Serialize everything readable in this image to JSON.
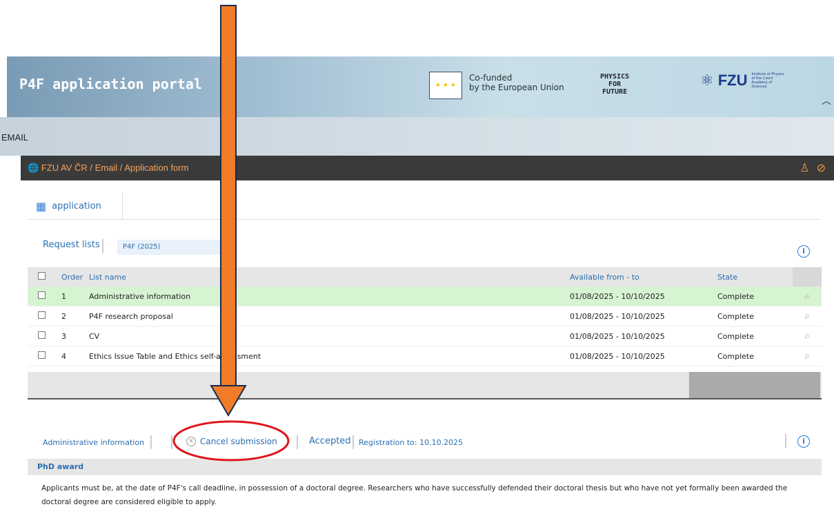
{
  "header": {
    "title": "P4F application portal",
    "eu_text_line1": "Co-funded",
    "eu_text_line2": "by the European Union",
    "p4f_line1": "PHYSICS",
    "p4f_line2": "FOR",
    "p4f_line3": "FUTURE",
    "fzu_word": "FZU",
    "fzu_small": "Institute of Physics of the Czech Academy of Sciences"
  },
  "section_bar": {
    "label": "EMAIL"
  },
  "breadcrumb": {
    "text": "FZU AV ČR / Email / Application form"
  },
  "tab": {
    "label": "application"
  },
  "request_lists": {
    "label": "Request lists",
    "selected": "P4F (2025)"
  },
  "table": {
    "headers": {
      "order": "Order",
      "name": "List name",
      "available": "Available from - to",
      "state": "State"
    },
    "rows": [
      {
        "order": "1",
        "name": "Administrative information",
        "available": "01/08/2025 - 10/10/2025",
        "state": "Complete"
      },
      {
        "order": "2",
        "name": "P4F research proposal",
        "available": "01/08/2025 - 10/10/2025",
        "state": "Complete"
      },
      {
        "order": "3",
        "name": "CV",
        "available": "01/08/2025 - 10/10/2025",
        "state": "Complete"
      },
      {
        "order": "4",
        "name": "Ethics Issue Table and Ethics self-assessment",
        "available": "01/08/2025 - 10/10/2025",
        "state": "Complete"
      }
    ],
    "page_size": "10"
  },
  "detail": {
    "list_name": "Administrative information",
    "cancel_label": "Cancel submission",
    "status": "Accepted",
    "registration": "Registration to: 10.10.2025",
    "section_title": "PhD award",
    "paragraph": "Applicants must be, at the date of P4F's call deadline, in possession of a doctoral degree. Researchers who have successfully defended their doctoral thesis but who have not yet formally been awarded the doctoral degree are considered eligible to apply."
  },
  "colors": {
    "accent_orange": "#f07c2a",
    "highlight_red": "#e0141c",
    "link_blue": "#2a6fb0"
  }
}
